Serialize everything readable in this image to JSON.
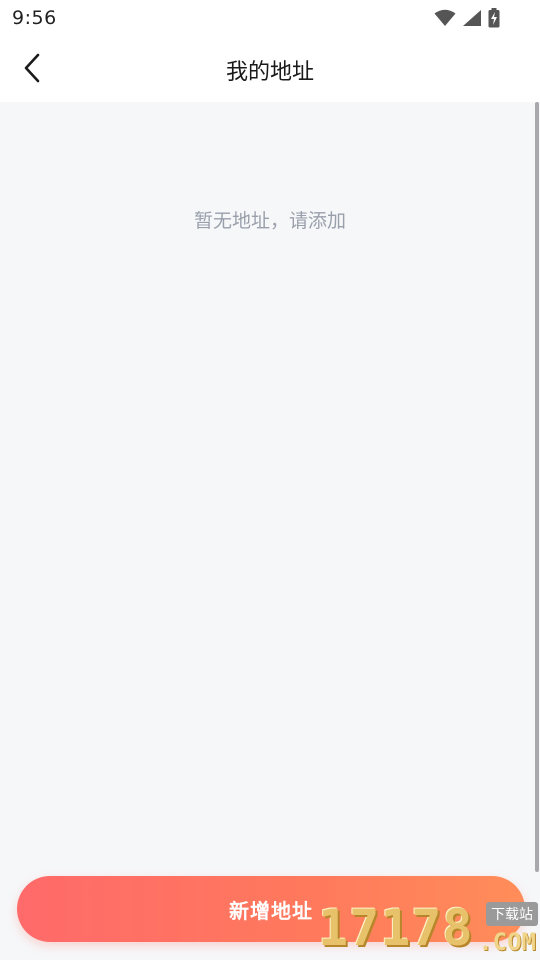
{
  "status_bar": {
    "time": "9:56",
    "icons": [
      "wifi-icon",
      "signal-icon",
      "battery-charging-icon"
    ]
  },
  "header": {
    "title": "我的地址",
    "back_icon": "chevron-left-icon"
  },
  "main": {
    "empty_message": "暂无地址，请添加"
  },
  "footer": {
    "add_button_label": "新增地址"
  },
  "watermark": {
    "digits": "17178",
    "suffix": ".COM",
    "badge": "下载站"
  },
  "colors": {
    "accent_start": "#ff6a6a",
    "accent_end": "#ff8d59",
    "background": "#f6f7f9",
    "empty_text": "#9aa0ab"
  }
}
